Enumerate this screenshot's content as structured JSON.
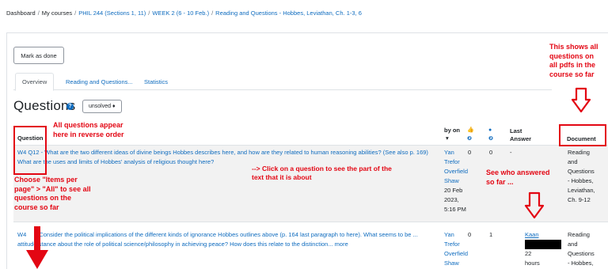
{
  "breadcrumb": [
    "Dashboard",
    "My courses",
    "PHIL 244 (Sections 1, 11)",
    "WEEK 2 (6 - 10 Feb.)",
    "Reading and Questions - Hobbes, Leviathan, Ch. 1-3, 6"
  ],
  "mark_done_label": "Mark as done",
  "tabs": [
    {
      "label": "Overview",
      "active": true
    },
    {
      "label": "Reading and Questions...",
      "active": false
    },
    {
      "label": "Statistics",
      "active": false
    }
  ],
  "heading": "Questions",
  "help_icon": "?",
  "filter": {
    "selected": "unsolved ♦"
  },
  "table": {
    "headers": {
      "question": "Question",
      "by_on": "by on",
      "by_on_sort": "▾",
      "likes_icon": "👍",
      "likes_count": "❷",
      "comments_icon": "●",
      "comments_count": "❷",
      "last_answer": "Last Answer",
      "document": "Document"
    },
    "rows": [
      {
        "qid": "W4 Q12",
        "text": "- What are the two different ideas of divine beings Hobbes describes here, and how are they related to human reasoning abilities? (See also p. 169) What are the uses and limits of Hobbes' analysis of religious thought here?",
        "author": [
          "Yan",
          "Trefor",
          "Overfield",
          "Shaw",
          "20 Feb",
          "2023,",
          "5:16 PM"
        ],
        "likes": "0",
        "comments": "0",
        "last_answer": "-",
        "document": [
          "Reading",
          "and",
          "Questions",
          "- Hobbes,",
          "Leviathan,",
          "Ch. 9-12"
        ]
      },
      {
        "qid": "W4",
        "text": "Consider the political implications of the different kinds of ignorance Hobbes outlines above (p. 164 last paragraph to here). What seems to be ... attitude/stance about the role of political science/philosophy in achieving peace? How does this relate to the distinction...",
        "more": "more",
        "author": [
          "Yan",
          "Trefor",
          "Overfield",
          "Shaw"
        ],
        "likes": "0",
        "comments": "1",
        "last_answer": [
          "Kaan",
          "",
          "22",
          "hours"
        ],
        "document": [
          "Reading",
          "and",
          "Questions",
          "- Hobbes,"
        ]
      }
    ]
  },
  "annotations": {
    "top_right": [
      "This shows all",
      "questions on",
      "all pdfs in the",
      "course so far"
    ],
    "reverse": [
      "All questions appear",
      "here in reverse order"
    ],
    "click": "--> Click on a question to see the part of the text that it is about",
    "who": [
      "See who answered",
      "so far ..."
    ],
    "items": [
      "Choose \"Items per",
      "page\" > \"All\" to see all",
      "questions on the",
      "course so far"
    ]
  }
}
